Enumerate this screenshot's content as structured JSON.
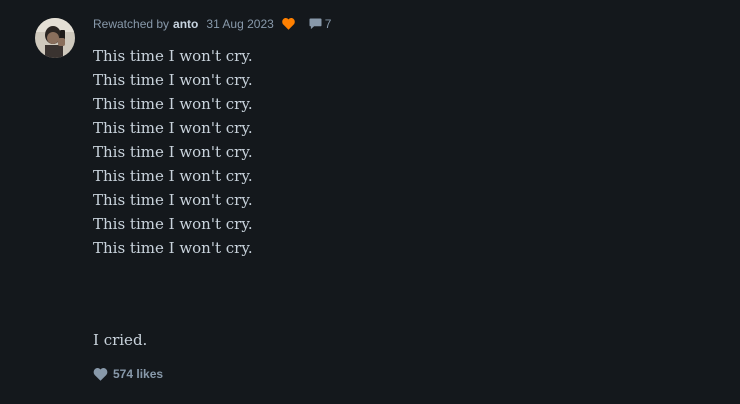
{
  "review": {
    "label": "Rewatched by",
    "username": "anto",
    "date": "31 Aug 2023",
    "comment_count": "7",
    "lines": [
      "This time I won't cry.",
      "This time I won't cry.",
      "This time I won't cry.",
      "This time I won't cry.",
      "This time I won't cry.",
      "This time I won't cry.",
      "This time I won't cry.",
      "This time I won't cry.",
      "This time I won't cry."
    ],
    "final_line": "I cried.",
    "likes_label": "574 likes"
  },
  "colors": {
    "background": "#14181c",
    "liked_heart": "#ff8000",
    "muted_text": "#8899aa",
    "body_text": "#c9d3dc"
  },
  "icons": {
    "liked": "orange-heart-icon",
    "comments": "speech-bubble-icon",
    "likes": "heart-icon"
  }
}
